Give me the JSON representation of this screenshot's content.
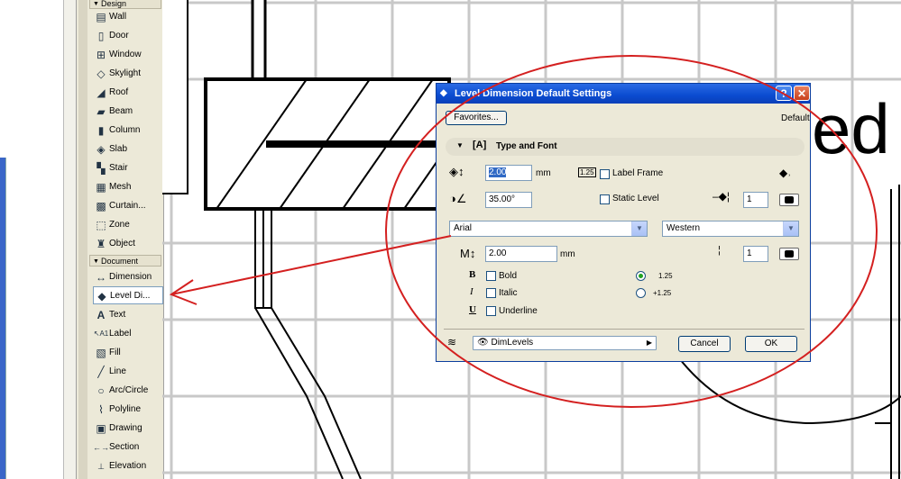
{
  "toolbox": {
    "design_header": "Design",
    "design_items": [
      {
        "label": "Wall",
        "icon": "wall-icon"
      },
      {
        "label": "Door",
        "icon": "door-icon"
      },
      {
        "label": "Window",
        "icon": "window-icon"
      },
      {
        "label": "Skylight",
        "icon": "skylight-icon"
      },
      {
        "label": "Roof",
        "icon": "roof-icon"
      },
      {
        "label": "Beam",
        "icon": "beam-icon"
      },
      {
        "label": "Column",
        "icon": "column-icon"
      },
      {
        "label": "Slab",
        "icon": "slab-icon"
      },
      {
        "label": "Stair",
        "icon": "stair-icon"
      },
      {
        "label": "Mesh",
        "icon": "mesh-icon"
      },
      {
        "label": "Curtain...",
        "icon": "curtain-wall-icon"
      },
      {
        "label": "Zone",
        "icon": "zone-icon"
      },
      {
        "label": "Object",
        "icon": "object-icon"
      }
    ],
    "document_header": "Document",
    "document_items": [
      {
        "label": "Dimension",
        "icon": "dimension-icon"
      },
      {
        "label": "Level Di...",
        "icon": "level-dimension-icon",
        "selected": true
      },
      {
        "label": "Text",
        "icon": "text-icon"
      },
      {
        "label": "Label",
        "icon": "label-icon"
      },
      {
        "label": "Fill",
        "icon": "fill-icon"
      },
      {
        "label": "Line",
        "icon": "line-icon"
      },
      {
        "label": "Arc/Circle",
        "icon": "arc-circle-icon"
      },
      {
        "label": "Polyline",
        "icon": "polyline-icon"
      },
      {
        "label": "Drawing",
        "icon": "drawing-icon"
      },
      {
        "label": "Section",
        "icon": "section-icon"
      },
      {
        "label": "Elevation",
        "icon": "elevation-icon"
      }
    ]
  },
  "canvas": {
    "partial_text": "ed"
  },
  "dialog": {
    "title": "Level Dimension Default Settings",
    "help_label": "?",
    "close_label": "✕",
    "favorites_label": "Favorites...",
    "default_label": "Default",
    "panel_title": "Type and Font",
    "marker_size_value": "2.00",
    "marker_size_unit": "mm",
    "label_frame_badge": "1.25",
    "label_frame_label": "Label Frame",
    "angle_value": "35.00°",
    "static_level_label": "Static Level",
    "marker_pen_value": "1",
    "font_name": "Arial",
    "font_encoding": "Western",
    "text_size_value": "2.00",
    "text_size_unit": "mm",
    "text_pen_value": "1",
    "bold_label": "Bold",
    "italic_label": "Italic",
    "underline_label": "Underline",
    "option_plain_label": "1.25",
    "option_plus_label": "+1.25",
    "layer_value": "DimLevels",
    "cancel_label": "Cancel",
    "ok_label": "OK",
    "option_plain_selected": true
  },
  "colors": {
    "annotation_red": "#d42020",
    "titlebar_blue": "#0a4bd0",
    "dialog_face": "#ece9d8"
  }
}
